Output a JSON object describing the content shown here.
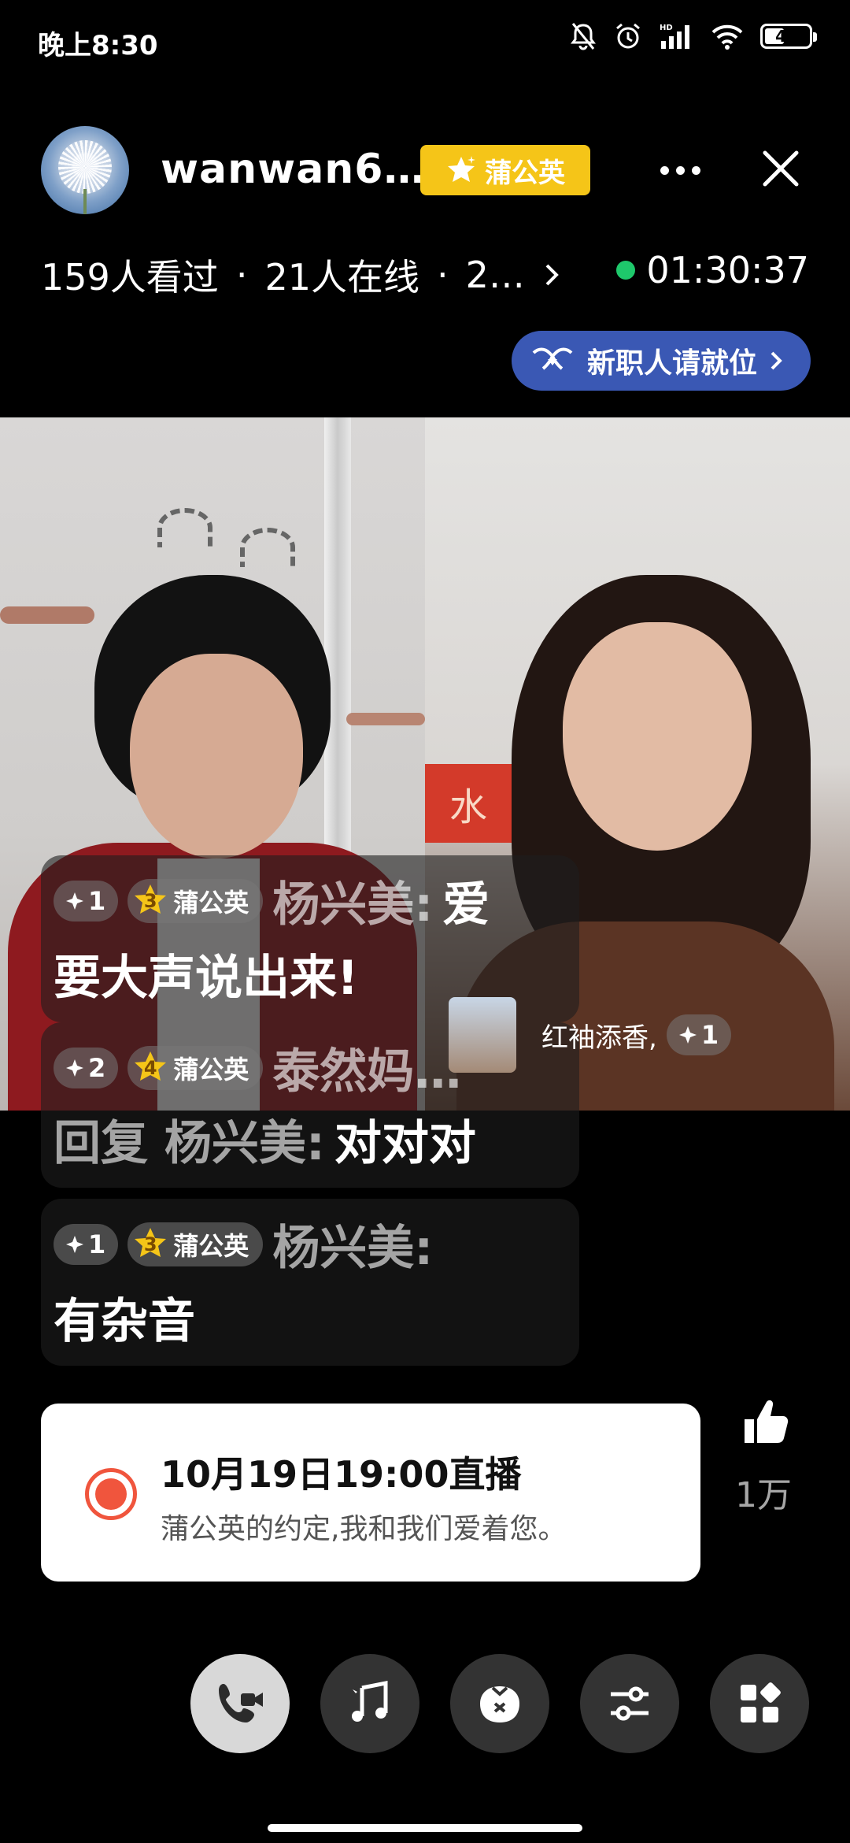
{
  "status_bar": {
    "time": "晚上8:30",
    "battery": "41",
    "icons": [
      "mute-bell-icon",
      "alarm-icon",
      "hd-signal-icon",
      "wifi-icon",
      "battery-icon"
    ]
  },
  "header": {
    "username": "wanwan6…",
    "badge_label": "蒲公英",
    "stats": {
      "viewed": "159人看过",
      "online": "21人在线",
      "extra": "2…"
    },
    "timer": "01:30:37",
    "job_pill": "新职人请就位"
  },
  "video": {
    "left_sign": "水"
  },
  "comments": [
    {
      "plus": "1",
      "level": "3",
      "badge": "蒲公英",
      "name": "杨兴美:",
      "text_tail": "爱",
      "text": "要大声说出来!"
    },
    {
      "plus": "2",
      "level": "4",
      "badge": "蒲公英",
      "name": "泰然妈…",
      "reply_prefix": "回复 杨兴美:",
      "text": "对对对"
    },
    {
      "plus": "1",
      "level": "3",
      "badge": "蒲公英",
      "name": "杨兴美:",
      "text": "有杂音"
    }
  ],
  "join_chip": {
    "name": "红袖添香,",
    "plus": "1"
  },
  "schedule": {
    "title": "10月19日19:00直播",
    "subtitle": "蒲公英的约定,我和我们爱着您。"
  },
  "likes": {
    "count": "1万"
  },
  "toolbar": {
    "items": [
      "video-call-icon",
      "music-icon",
      "gift-bag-icon",
      "settings-sliders-icon",
      "apps-grid-icon"
    ]
  },
  "colors": {
    "badge_gold": "#f5c518",
    "job_pill_blue": "#3a58b4",
    "live_green": "#1ec86b",
    "record_red": "#f0553d"
  }
}
